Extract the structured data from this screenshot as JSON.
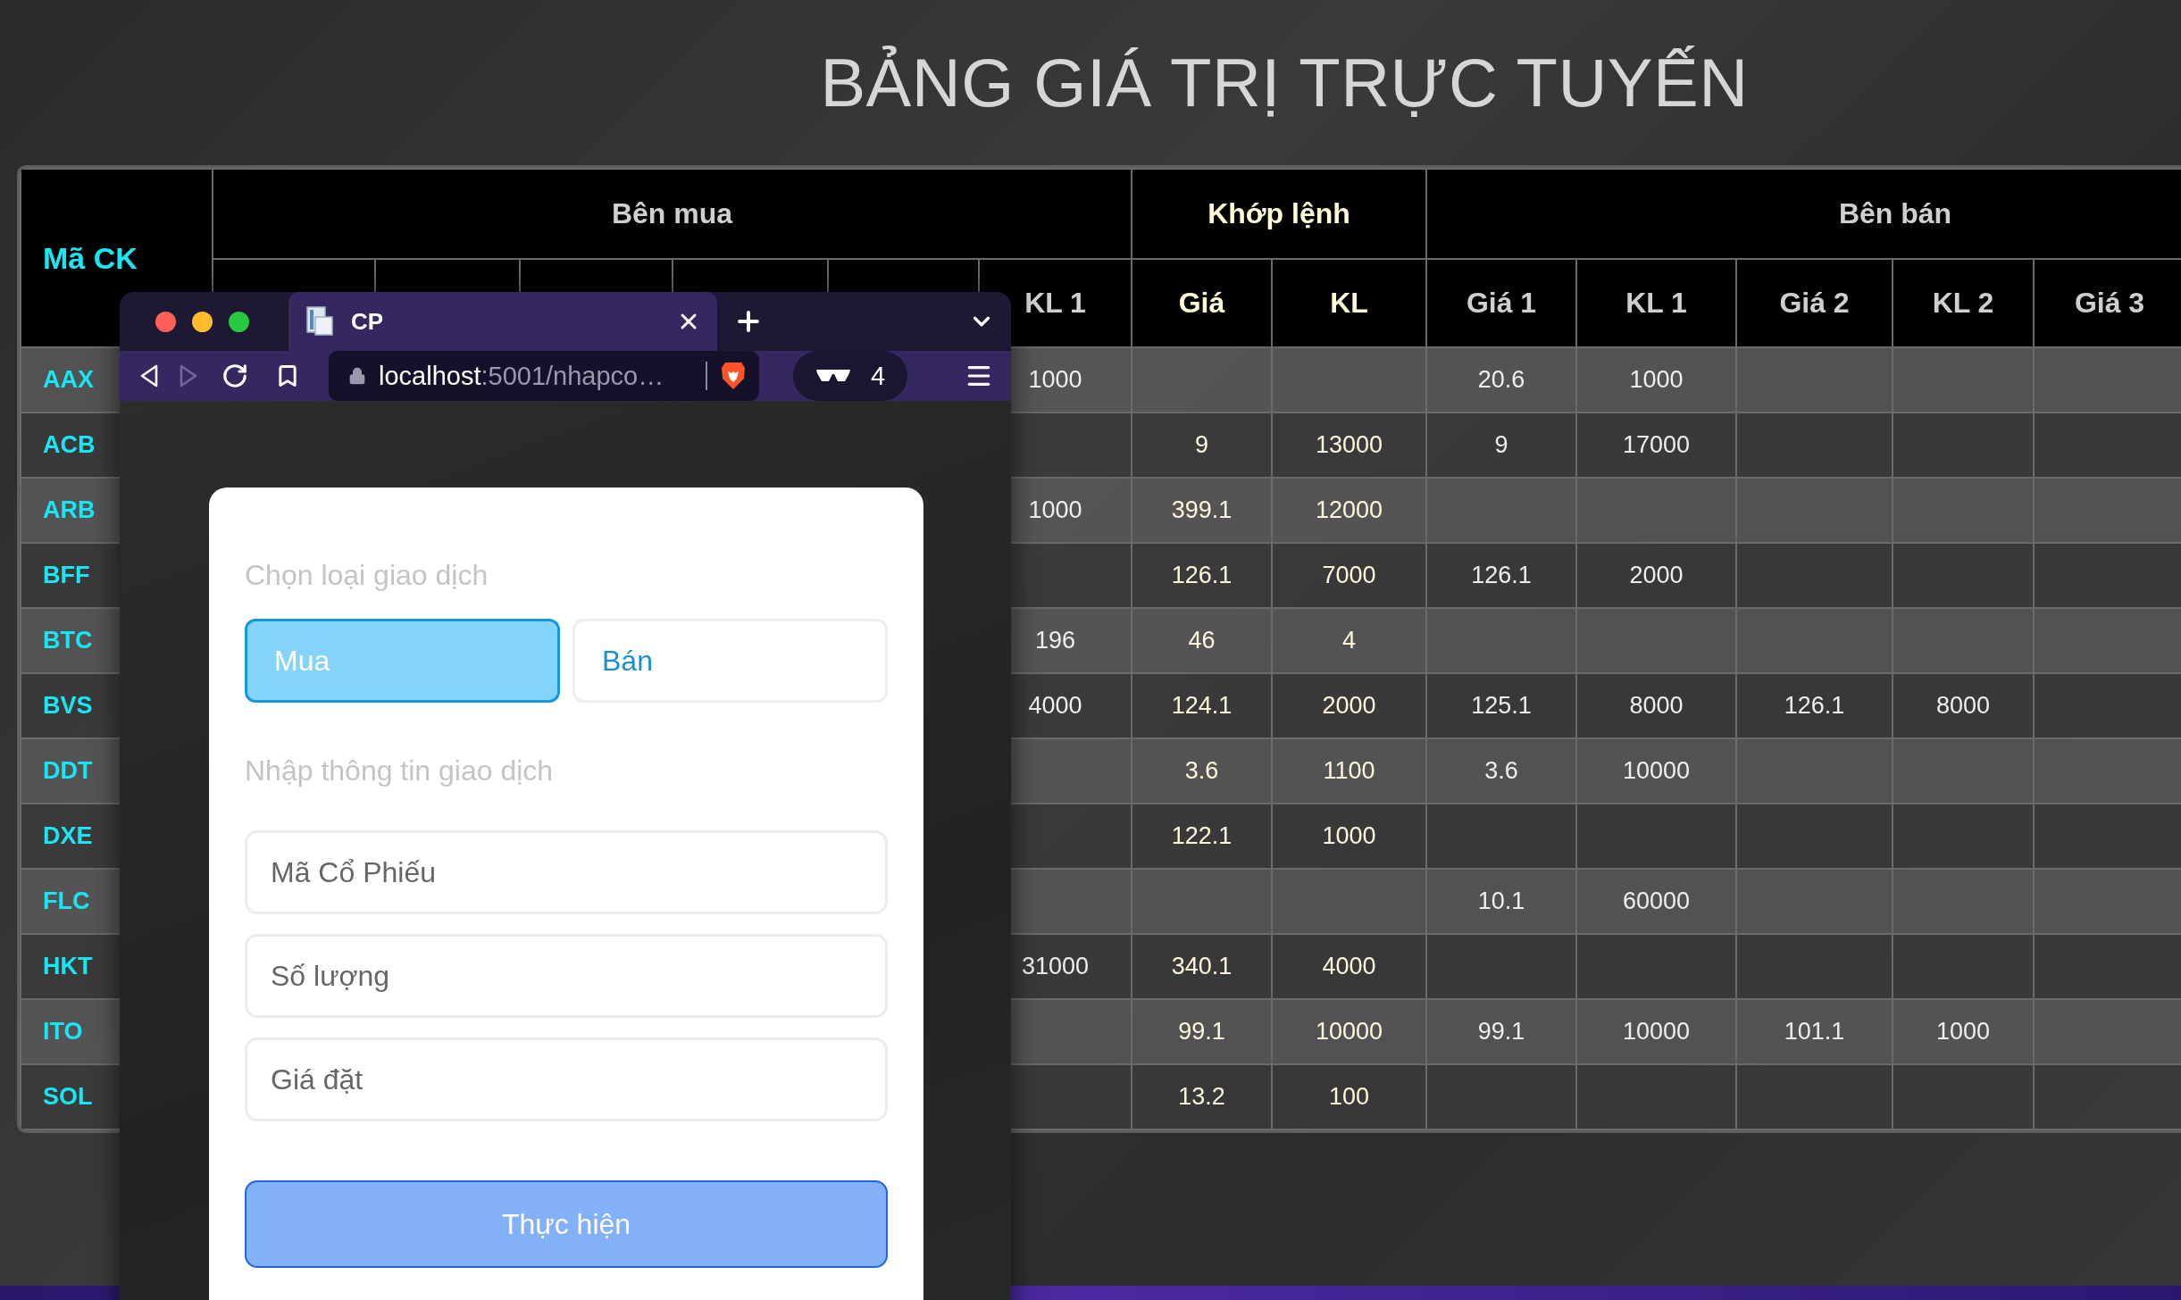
{
  "title": "BẢNG GIÁ TRỊ TRỰC TUYẾN",
  "table": {
    "symbol_header": "Mã CK",
    "groups": [
      {
        "kind": "buy",
        "label": "Bên mua",
        "columns": [
          "KL 1"
        ]
      },
      {
        "kind": "match",
        "label": "Khớp lệnh",
        "columns": [
          "Giá",
          "KL"
        ]
      },
      {
        "kind": "sell",
        "label": "Bên bán",
        "columns": [
          "Giá 1",
          "KL 1",
          "Giá 2",
          "KL 2",
          "Giá 3"
        ]
      }
    ],
    "rows": [
      {
        "symbol": "AAX",
        "cells": [
          "1000",
          null,
          null,
          "20.6",
          "1000",
          null,
          null,
          null
        ]
      },
      {
        "symbol": "ACB",
        "cells": [
          null,
          "9",
          "13000",
          "9",
          "17000",
          null,
          null,
          null
        ]
      },
      {
        "symbol": "ARB",
        "cells": [
          "1000",
          "399.1",
          "12000",
          null,
          null,
          null,
          null,
          null
        ]
      },
      {
        "symbol": "BFF",
        "cells": [
          null,
          "126.1",
          "7000",
          "126.1",
          "2000",
          null,
          null,
          null
        ]
      },
      {
        "symbol": "BTC",
        "cells": [
          "196",
          "46",
          "4",
          null,
          null,
          null,
          null,
          null
        ]
      },
      {
        "symbol": "BVS",
        "cells": [
          "4000",
          "124.1",
          "2000",
          "125.1",
          "8000",
          "126.1",
          "8000",
          null
        ]
      },
      {
        "symbol": "DDT",
        "cells": [
          null,
          "3.6",
          "1100",
          "3.6",
          "10000",
          null,
          null,
          null
        ]
      },
      {
        "symbol": "DXE",
        "cells": [
          null,
          "122.1",
          "1000",
          null,
          null,
          null,
          null,
          null
        ]
      },
      {
        "symbol": "FLC",
        "cells": [
          null,
          null,
          null,
          "10.1",
          "60000",
          null,
          null,
          null
        ]
      },
      {
        "symbol": "HKT",
        "cells": [
          "31000",
          "340.1",
          "4000",
          null,
          null,
          null,
          null,
          null
        ]
      },
      {
        "symbol": "ITO",
        "cells": [
          null,
          "99.1",
          "10000",
          "99.1",
          "10000",
          "101.1",
          "1000",
          null
        ]
      },
      {
        "symbol": "SOL",
        "cells": [
          null,
          "13.2",
          "100",
          null,
          null,
          null,
          null,
          null
        ]
      }
    ]
  },
  "browser": {
    "tab": {
      "title": "CP"
    },
    "address": {
      "host": "localhost",
      "path": ":5001/nhapco…"
    },
    "private_count": "4"
  },
  "form": {
    "type_label": "Chọn loại giao dịch",
    "trade_types": [
      {
        "label": "Mua",
        "selected": true
      },
      {
        "label": "Bán",
        "selected": false
      }
    ],
    "info_label": "Nhập thông tin giao dịch",
    "fields": [
      {
        "placeholder": "Mã Cổ Phiếu"
      },
      {
        "placeholder": "Số lượng"
      },
      {
        "placeholder": "Giá đặt"
      }
    ],
    "submit": "Thực hiện"
  }
}
